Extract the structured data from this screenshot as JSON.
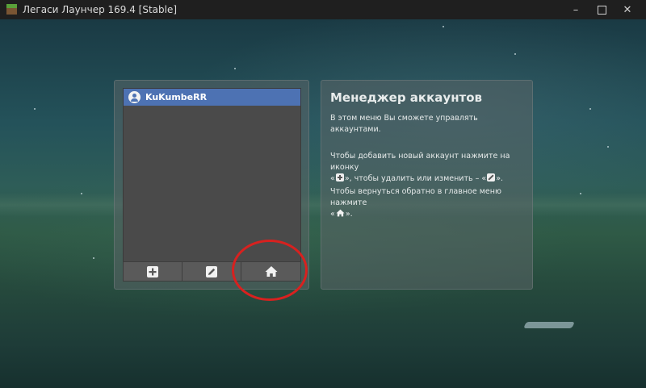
{
  "window": {
    "title": "Легаси Лаунчер 169.4 [Stable]",
    "icons": [
      "app-icon",
      "minimize-icon",
      "maximize-icon",
      "close-icon"
    ]
  },
  "accounts": {
    "items": [
      {
        "name": "KuKumbeRR",
        "selected": true
      }
    ],
    "toolbar": [
      {
        "name": "add-account-button",
        "icon": "plus-icon"
      },
      {
        "name": "edit-account-button",
        "icon": "pencil-icon"
      },
      {
        "name": "home-button",
        "icon": "house-icon"
      }
    ]
  },
  "info": {
    "title": "Менеджер аккаунтов",
    "p1": "В этом меню Вы сможете управлять аккаунтами.",
    "p2a": "Чтобы добавить новый аккаунт нажмите на иконку",
    "p2b": "«",
    "p2c": "», чтобы удалить или изменить – «",
    "p2d": "».",
    "p3a": "Чтобы вернуться обратно в главное меню нажмите",
    "p3b": "«",
    "p3c": "»."
  },
  "colors": {
    "selected_row": "#4d72b3",
    "annotation_circle": "#d8211f"
  }
}
